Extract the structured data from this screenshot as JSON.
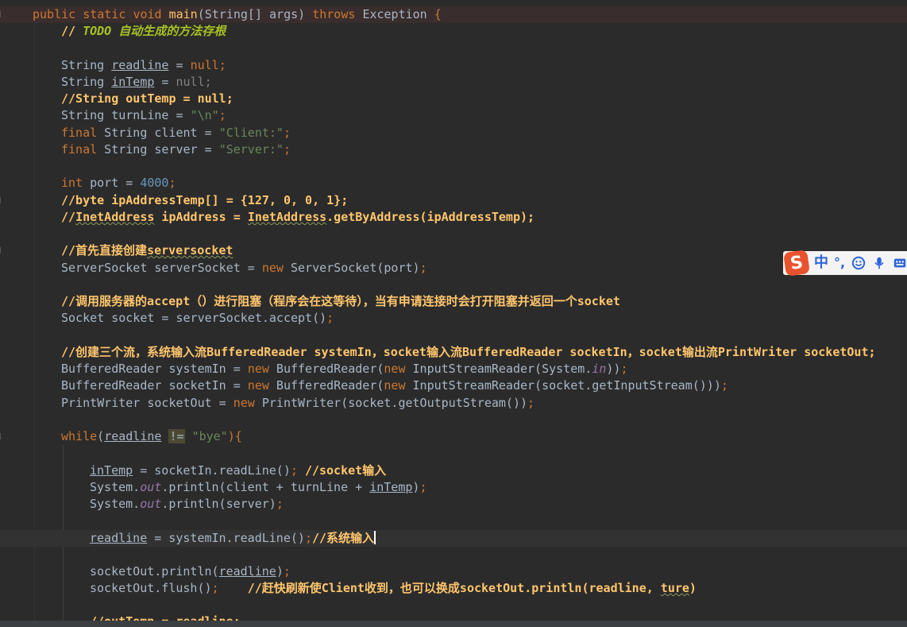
{
  "code": {
    "l1": {
      "kw_public": "public",
      "kw_static": "static",
      "kw_void": "void",
      "method": "main",
      "params": "(String[] args)",
      "kw_throws": "throws",
      "exception": "Exception",
      "brace": "{"
    },
    "l2": {
      "slashes": "// ",
      "todo": "TODO",
      "rest": " 自动生成的方法存根"
    },
    "l4": {
      "type": "String",
      "var": "readline",
      "eq": " = ",
      "val": "null",
      "semi": ";"
    },
    "l5": {
      "type": "String",
      "var": "inTemp",
      "eq": " = ",
      "val": "null",
      "semi": ";"
    },
    "l6": "//String outTemp = null;",
    "l7": {
      "type": "String turnLine = ",
      "val": "\"\\n\"",
      "semi": ";"
    },
    "l8": {
      "kw": "final",
      "rest": " String client = ",
      "val": "\"Client:\"",
      "semi": ";"
    },
    "l9": {
      "kw": "final",
      "rest": " String server = ",
      "val": "\"Server:\"",
      "semi": ";"
    },
    "l11": {
      "kw": "int",
      "rest": " port = ",
      "val": "4000",
      "semi": ";"
    },
    "l12": "//byte ipAddressTemp[] = {127, 0, 0, 1};",
    "l13": {
      "a": "//",
      "b": "InetAddress",
      "c": " ipAddress = ",
      "d": "InetAddress",
      "e": ".getByAddress(ipAddressTemp);"
    },
    "l15": {
      "a": "//首先直接创建",
      "b": "serversocket"
    },
    "l16": {
      "a": "ServerSocket serverSocket = ",
      "kw": "new",
      "b": " ServerSocket(port)",
      "semi": ";"
    },
    "l18": "//调用服务器的accept（）进行阻塞（程序会在这等待），当有申请连接时会打开阻塞并返回一个socket",
    "l19": {
      "a": "Socket socket = serverSocket.accept()",
      "semi": ";"
    },
    "l21": "//创建三个流，系统输入流BufferedReader systemIn，socket输入流BufferedReader socketIn，socket输出流PrintWriter socketOut;",
    "l22": {
      "a": "BufferedReader systemIn = ",
      "kw1": "new",
      "b": " BufferedReader(",
      "kw2": "new",
      "c": " InputStreamReader(System.",
      "fld": "in",
      "d": "))",
      "semi": ";"
    },
    "l23": {
      "a": "BufferedReader socketIn = ",
      "kw1": "new",
      "b": " BufferedReader(",
      "kw2": "new",
      "c": " InputStreamReader(socket.getInputStream()))",
      "semi": ";"
    },
    "l24": {
      "a": "PrintWriter socketOut = ",
      "kw": "new",
      "b": " PrintWriter(socket.getOutputStream())",
      "semi": ";"
    },
    "l26": {
      "kw": "while",
      "a": "(",
      "var": "readline",
      "sp": " ",
      "op": "!=",
      "b": " ",
      "val": "\"bye\"",
      "c": "){"
    },
    "l28": {
      "var": "inTemp",
      "a": " = socketIn.readLine()",
      "semi": ";",
      "sp": " ",
      "cm": "//socket输入"
    },
    "l29": {
      "a": "System.",
      "fld": "out",
      "b": ".println(client + turnLine + ",
      "var": "inTemp",
      "c": ")",
      "semi": ";"
    },
    "l30": {
      "a": "System.",
      "fld": "out",
      "b": ".println(server)",
      "semi": ";"
    },
    "l32": {
      "var": "readline",
      "a": " = systemIn.readLine()",
      "semi": ";",
      "cm": "//系统输入"
    },
    "l34": {
      "a": "socketOut.println(",
      "var": "readline",
      "b": ")",
      "semi": ";"
    },
    "l35": {
      "a": "socketOut.flush()",
      "semi": ";",
      "sp": "    ",
      "cm": "//赶快刷新使Client收到，也可以换成socketOut.println(readline, ",
      "cm2": "ture",
      "cm3": ")"
    },
    "l37": "//outTemp = readline;"
  },
  "ime": {
    "logo": "S",
    "mode": "中",
    "punct": "°,"
  },
  "colors": {
    "background": "#2b2b2b",
    "keyword": "#cc7832",
    "string": "#6a8759",
    "number": "#6897bb",
    "field": "#9876aa",
    "comment_bold": "#ffc66d",
    "text": "#a9b7c6",
    "ime_accent": "#2a63d8",
    "ime_logo": "#e8532d"
  }
}
